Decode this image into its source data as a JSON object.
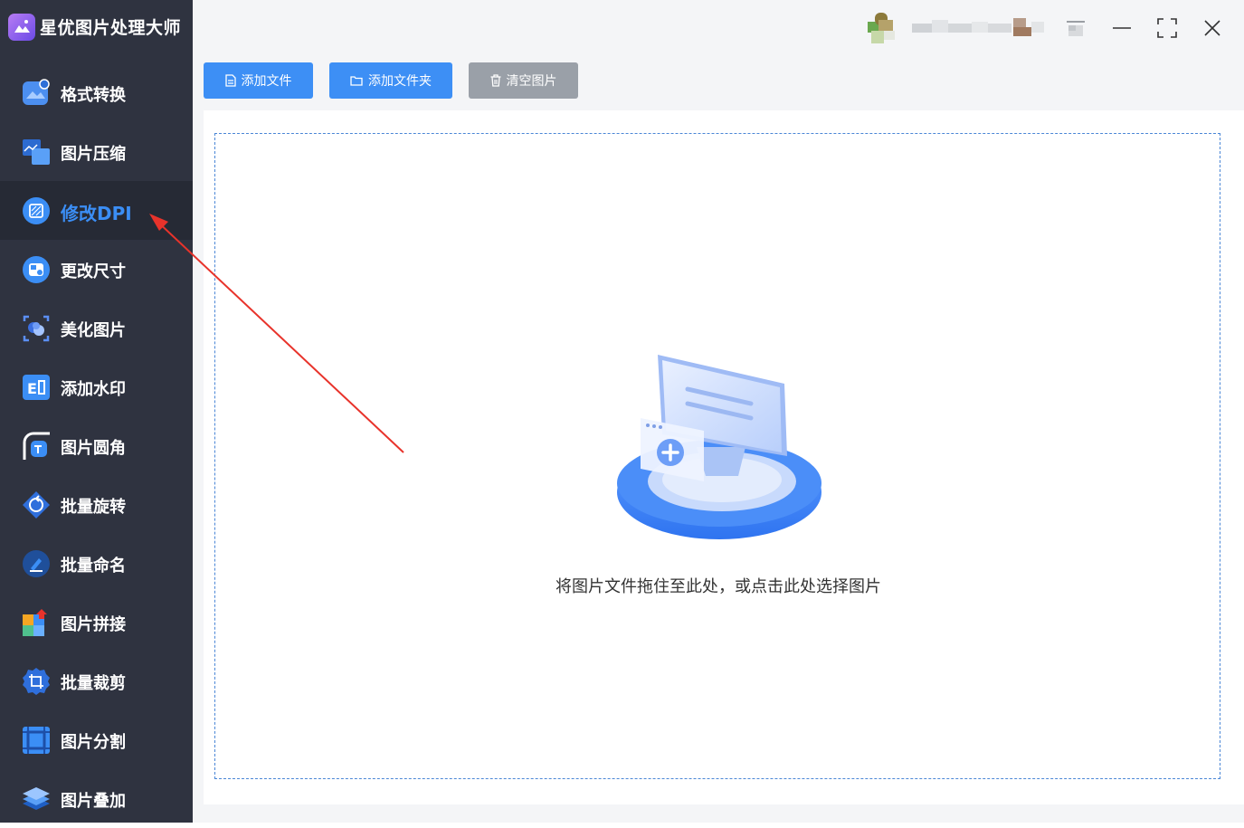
{
  "app": {
    "title": "星优图片处理大师"
  },
  "sidebar": {
    "items": [
      {
        "label": "格式转换",
        "icon": "format-convert-icon"
      },
      {
        "label": "图片压缩",
        "icon": "compress-icon"
      },
      {
        "label": "修改DPI",
        "icon": "dpi-icon",
        "active": true
      },
      {
        "label": "更改尺寸",
        "icon": "resize-icon"
      },
      {
        "label": "美化图片",
        "icon": "beautify-icon"
      },
      {
        "label": "添加水印",
        "icon": "watermark-icon"
      },
      {
        "label": "图片圆角",
        "icon": "round-corner-icon"
      },
      {
        "label": "批量旋转",
        "icon": "rotate-icon"
      },
      {
        "label": "批量命名",
        "icon": "rename-icon"
      },
      {
        "label": "图片拼接",
        "icon": "stitch-icon"
      },
      {
        "label": "批量裁剪",
        "icon": "crop-icon"
      },
      {
        "label": "图片分割",
        "icon": "split-icon"
      },
      {
        "label": "图片叠加",
        "icon": "overlay-icon"
      }
    ]
  },
  "toolbar": {
    "add_file": "添加文件",
    "add_folder": "添加文件夹",
    "clear_images": "清空图片"
  },
  "dropzone": {
    "hint": "将图片文件拖住至此处，或点击此处选择图片"
  },
  "colors": {
    "sidebar_bg": "#2f3340",
    "active_bg": "#262a35",
    "accent": "#3b8ef5",
    "button_blue": "#3d8ff5",
    "button_gray": "#9aa0a8",
    "annotation": "#e8332b"
  }
}
